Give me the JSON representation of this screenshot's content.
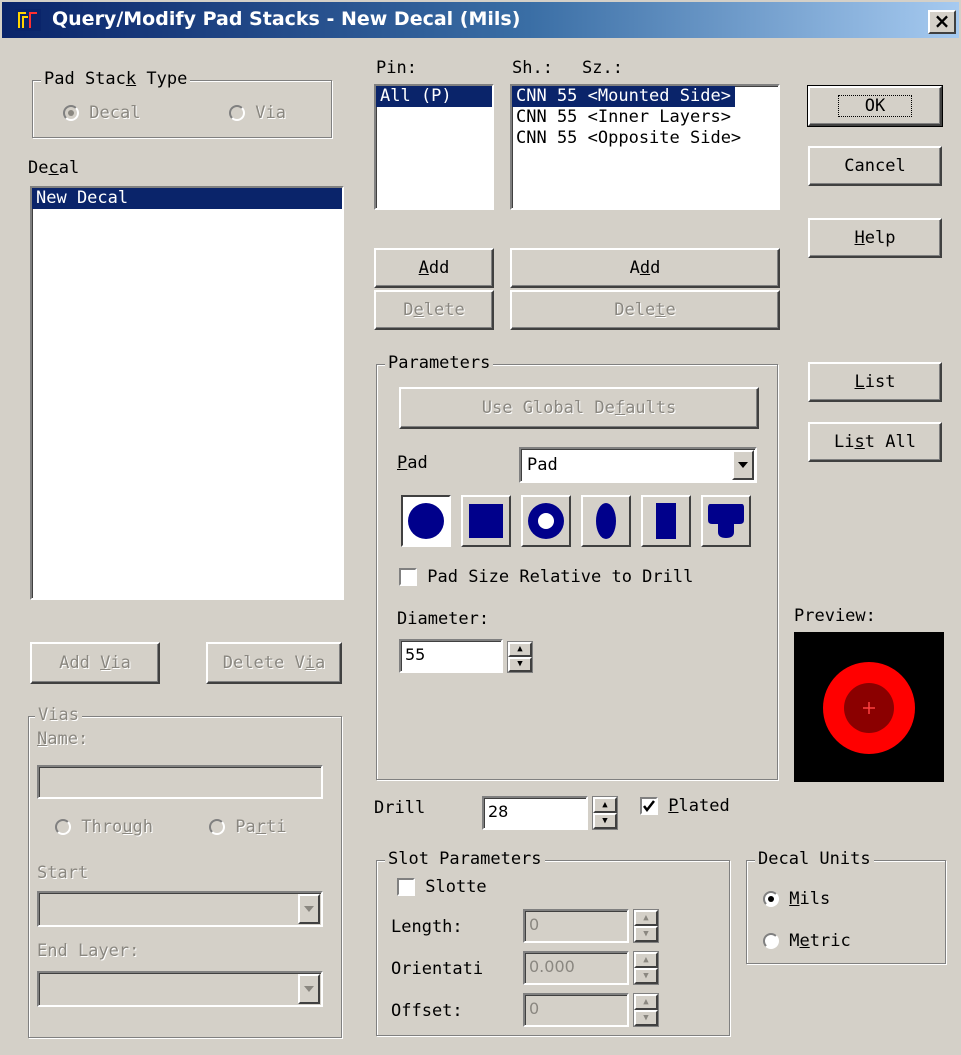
{
  "window": {
    "title": "Query/Modify Pad Stacks - New Decal (Mils)",
    "close": "×"
  },
  "pad_stack_type": {
    "legend": "Pad Stack Type",
    "decal": "Decal",
    "via": "Via",
    "selected": "Decal"
  },
  "decal": {
    "label": "Decal",
    "items": [
      "New Decal"
    ]
  },
  "pin": {
    "label": "Pin:",
    "items": [
      "All (P)"
    ]
  },
  "shape": {
    "sh_label": "Sh.:",
    "sz_label": "Sz.:",
    "items": [
      "CNN 55 <Mounted Side>",
      "CNN 55 <Inner Layers>",
      "CNN 55 <Opposite Side>"
    ]
  },
  "buttons": {
    "ok": "OK",
    "cancel": "Cancel",
    "help": "Help",
    "list": "List",
    "list_all": "List All",
    "pin_add": "Add",
    "pin_delete": "Delete",
    "shape_add": "Add",
    "shape_delete": "Delete",
    "add_via": "Add Via",
    "delete_via": "Delete Via"
  },
  "parameters": {
    "legend": "Parameters",
    "use_global": "Use Global Defaults",
    "pad_label": "Pad",
    "pad_value": "Pad",
    "pad_size_relative": "Pad Size Relative to Drill",
    "diameter_label": "Diameter:",
    "diameter_value": "55",
    "shape_icons": [
      "round-pad-icon",
      "square-pad-icon",
      "annular-pad-icon",
      "oval-pad-icon",
      "rectangle-pad-icon",
      "odd-shape-pad-icon"
    ]
  },
  "preview": {
    "label": "Preview:",
    "colors": {
      "outer": "#ff0000",
      "inner": "#8b0000",
      "background": "#000000"
    }
  },
  "drill": {
    "label": "Drill",
    "value": "28",
    "plated_label": "Plated",
    "plated": true
  },
  "slot": {
    "legend": "Slot Parameters",
    "slotted_label": "Slotte",
    "length_label": "Length:",
    "length_value": "0",
    "orientation_label": "Orientati",
    "orientation_value": "0.000",
    "offset_label": "Offset:",
    "offset_value": "0"
  },
  "decal_units": {
    "legend": "Decal Units",
    "mils": "Mils",
    "metric": "Metric",
    "selected": "Mils"
  },
  "vias": {
    "legend": "Vias",
    "name_label": "Name:",
    "through": "Through",
    "partial": "Parti",
    "start_label": "Start",
    "end_label": "End Layer:"
  }
}
